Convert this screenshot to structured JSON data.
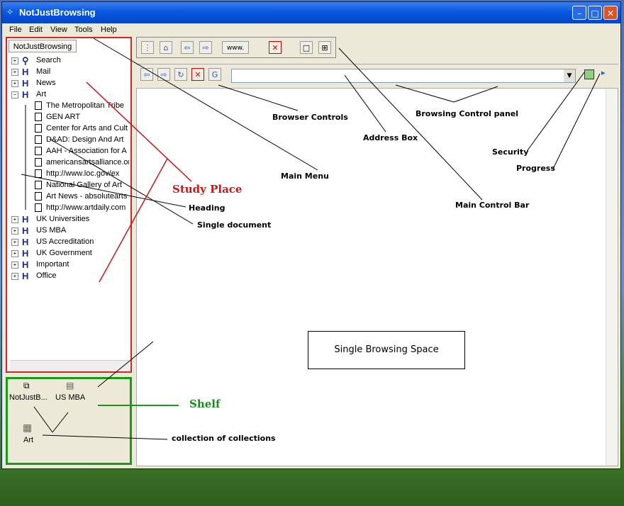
{
  "window": {
    "title": "NotJustBrowsing",
    "app_icon": "notjustbrowsing-icon"
  },
  "menu": [
    "File",
    "Edit",
    "View",
    "Tools",
    "Help"
  ],
  "study_place": {
    "tab_label": "NotJustBrowsing",
    "tree": [
      {
        "label": "Search",
        "type": "search",
        "expanded": false
      },
      {
        "label": "Mail",
        "type": "heading",
        "expanded": false
      },
      {
        "label": "News",
        "type": "heading",
        "expanded": false
      },
      {
        "label": "Art",
        "type": "heading",
        "expanded": true,
        "children": [
          "The Metropolitan Tribe",
          "GEN ART",
          "Center for Arts and Cult",
          "D&AD: Design And Art",
          "AAH - Association for A",
          "americansartsalliance.or",
          "http://www.loc.gov/ex",
          "National Gallery of Art",
          "Art News - absolutearts",
          "http://www.artdaily.com"
        ]
      },
      {
        "label": "UK Universities",
        "type": "heading",
        "expanded": false
      },
      {
        "label": "US MBA",
        "type": "heading",
        "expanded": false
      },
      {
        "label": "US Accreditation",
        "type": "heading",
        "expanded": false
      },
      {
        "label": "UK Government",
        "type": "heading",
        "expanded": false
      },
      {
        "label": "Important",
        "type": "heading",
        "expanded": false
      },
      {
        "label": "Office",
        "type": "heading",
        "expanded": false
      }
    ]
  },
  "shelf": {
    "items": [
      "NotJustB...",
      "US MBA",
      "Art"
    ]
  },
  "toolbar": {
    "address_value": "",
    "site_select_value": "www."
  },
  "content": {
    "box_label": "Single Browsing Space"
  },
  "annotations": {
    "study_place": "Study Place",
    "heading": "Heading",
    "single_document": "Single document",
    "shelf": "Shelf",
    "collection_of_collections": "collection of collections",
    "browser_controls": "Browser Controls",
    "address_box": "Address Box",
    "browsing_control_panel": "Browsing Control panel",
    "main_menu": "Main Menu",
    "main_control_bar": "Main Control Bar",
    "security": "Security",
    "progress": "Progress"
  },
  "colors": {
    "study_border": "#d22222",
    "shelf_border": "#1a9a1a",
    "title_bar": "#0a58e0"
  }
}
